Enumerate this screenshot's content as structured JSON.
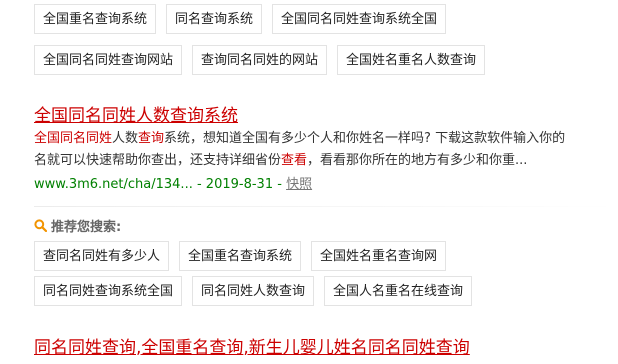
{
  "top_related": {
    "row1": [
      "全国重名查询系统",
      "同名查询系统",
      "全国同名同姓查询系统全国"
    ],
    "row2": [
      "全国同名同姓查询网站",
      "查询同名同姓的网站",
      "全国姓名重名人数查询"
    ]
  },
  "result1": {
    "title": "全国同名同姓人数查询系统",
    "snippet_parts": [
      {
        "t": "全国同名同姓",
        "hl": true
      },
      {
        "t": "人数",
        "hl": false
      },
      {
        "t": "查询",
        "hl": true
      },
      {
        "t": "系统，想知道全国有多少个人和你姓名一样吗? 下载这款软件输入你的",
        "hl": false
      },
      {
        "t": "名就可以快速帮助你查出，还支持详细省份",
        "hl": false
      },
      {
        "t": "查看",
        "hl": true
      },
      {
        "t": "，看看那你所在的地方有多少和你重...",
        "hl": false
      }
    ],
    "url": "www.3m6.net/cha/134...",
    "date": "- 2019-8-31 -",
    "cache_label": "快照"
  },
  "recommend": {
    "title": "推荐您搜索:",
    "row1": [
      "查同名同姓有多少人",
      "全国重名查询系统",
      "全国姓名重名查询网"
    ],
    "row2": [
      "同名同姓查询系统全国",
      "同名同姓人数查询",
      "全国人名重名在线查询"
    ]
  },
  "result2": {
    "title_parts": [
      {
        "t": "同名同姓查询",
        "hl": true
      },
      {
        "t": ",",
        "hl": false
      },
      {
        "t": "全国重名查询",
        "hl": true
      },
      {
        "t": ",新生儿婴儿姓名",
        "hl": false
      },
      {
        "t": "同名同姓查询",
        "hl": true
      }
    ]
  },
  "colors": {
    "link_red": "#cc0000",
    "url_green": "#008000",
    "search_icon": "#f29400"
  }
}
